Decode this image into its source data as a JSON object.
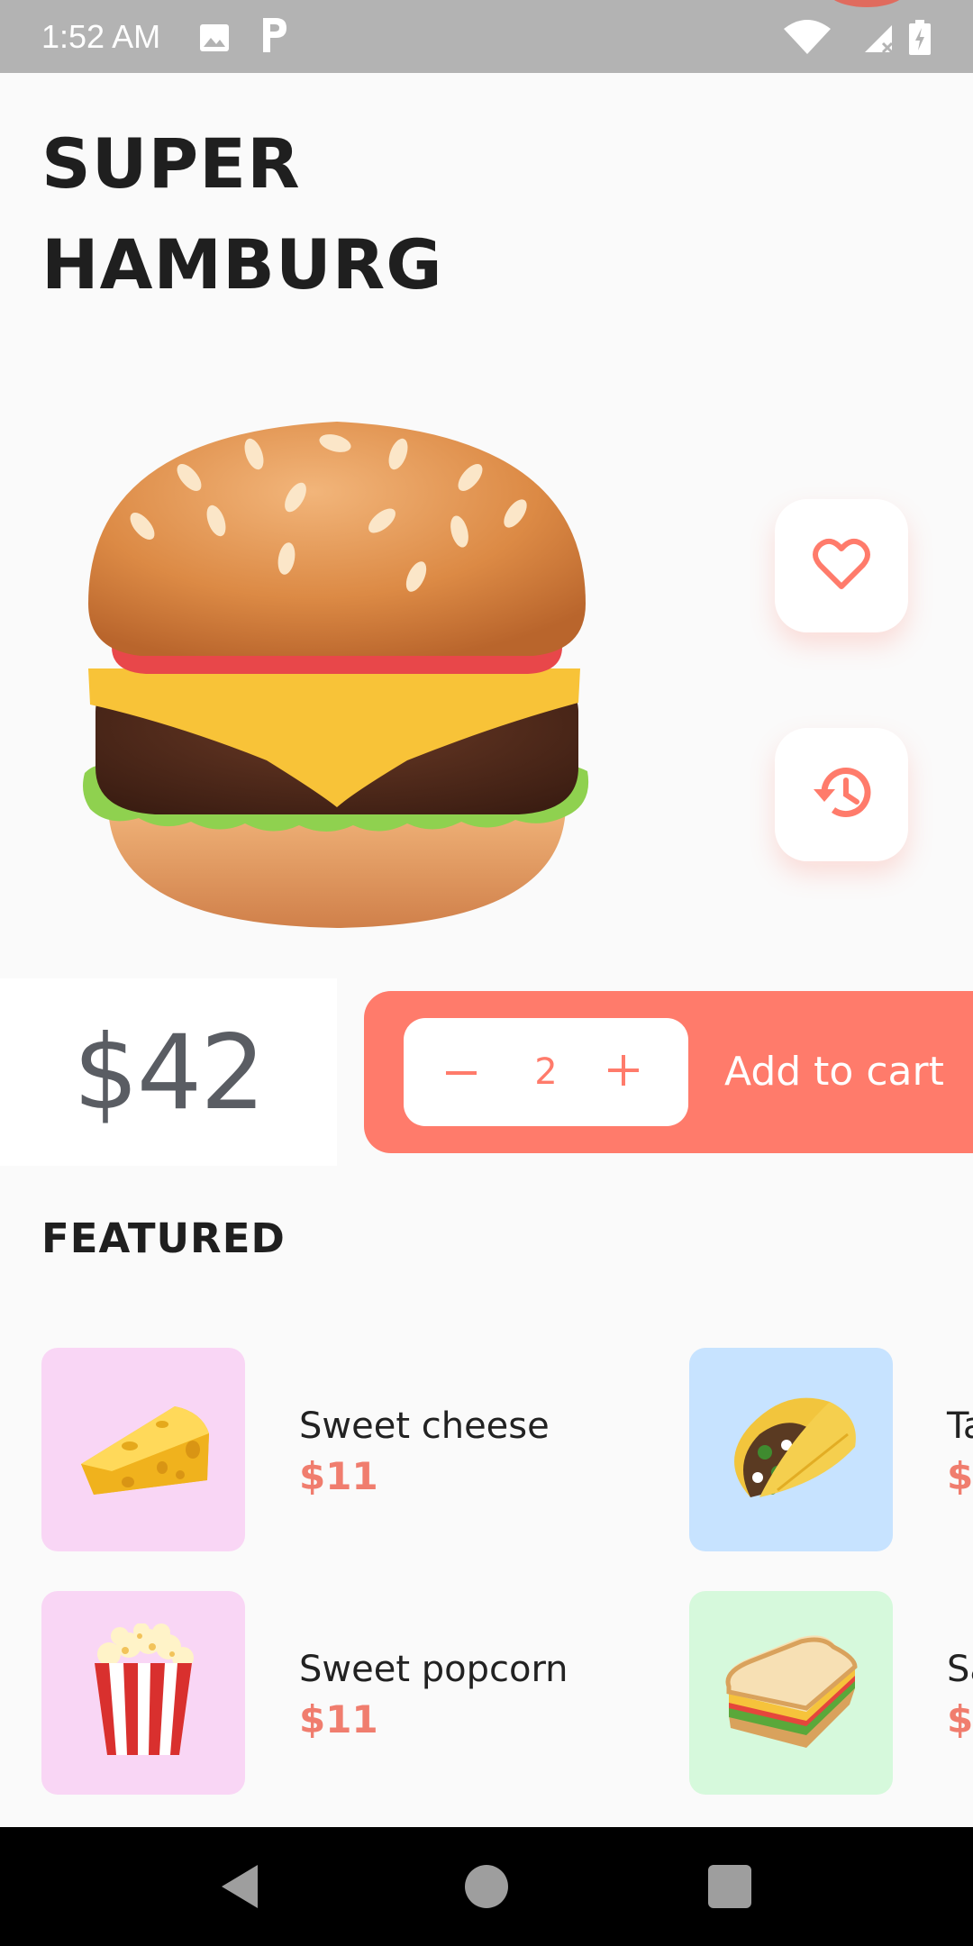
{
  "status_bar": {
    "time": "1:52 AM",
    "icons": [
      "image-icon",
      "parking-icon",
      "wifi-icon",
      "signal-icon",
      "battery-charging-icon"
    ]
  },
  "product": {
    "title_line1": "SUPER",
    "title_line2": "HAMBURG",
    "image": "hamburger-emoji",
    "price": "$42"
  },
  "actions": {
    "favorite_icon": "heart-icon",
    "history_icon": "history-icon"
  },
  "cart": {
    "quantity": "2",
    "minus_icon": "minus-icon",
    "plus_icon": "plus-icon",
    "add_label": "Add to cart"
  },
  "featured": {
    "title": "FEATURED",
    "items": [
      {
        "name": "Sweet cheese",
        "price": "$11",
        "image": "cheese-emoji",
        "tile_color": "#f9d6f5"
      },
      {
        "name": "Ta",
        "price": "$",
        "image": "taco-emoji",
        "tile_color": "#c7e3ff"
      },
      {
        "name": "Sweet popcorn",
        "price": "$11",
        "image": "popcorn-emoji",
        "tile_color": "#f9d6f5"
      },
      {
        "name": "Sa",
        "price": "$",
        "image": "sandwich-emoji",
        "tile_color": "#d6f9dc"
      }
    ]
  },
  "colors": {
    "accent": "#ff7b6b",
    "price_text": "#5a5d63",
    "background": "#fafafa"
  },
  "nav_bar": {
    "icons": [
      "back-icon",
      "home-icon",
      "recents-icon"
    ]
  }
}
